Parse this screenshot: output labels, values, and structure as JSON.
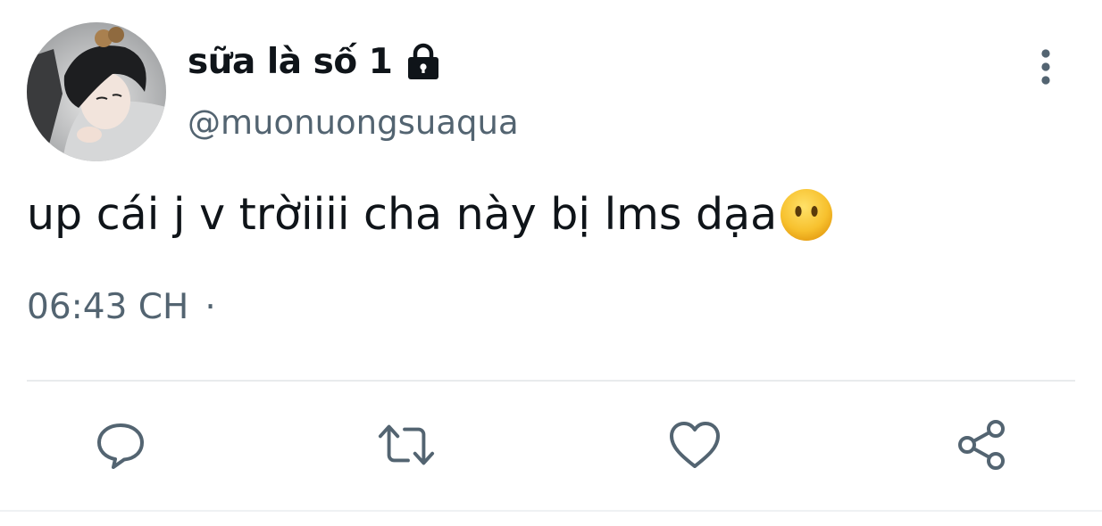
{
  "author": {
    "display_name": "sữa là số 1",
    "handle": "@muonuongsuaqua",
    "protected": true,
    "avatar": "profile-photo"
  },
  "tweet": {
    "text": "up cái j v trờiiii cha này bị lms dạa",
    "emoji": "face-without-mouth-icon",
    "time": "06:43 CH",
    "separator": "·"
  },
  "actions": {
    "reply_icon": "reply-icon",
    "retweet_icon": "retweet-icon",
    "like_icon": "heart-icon",
    "share_icon": "share-icon",
    "more_icon": "more-vertical-icon"
  },
  "colors": {
    "text_primary": "#0f1419",
    "text_secondary": "#536471",
    "divider": "#e8ebed",
    "emoji_yellow": "#f7c12e"
  }
}
